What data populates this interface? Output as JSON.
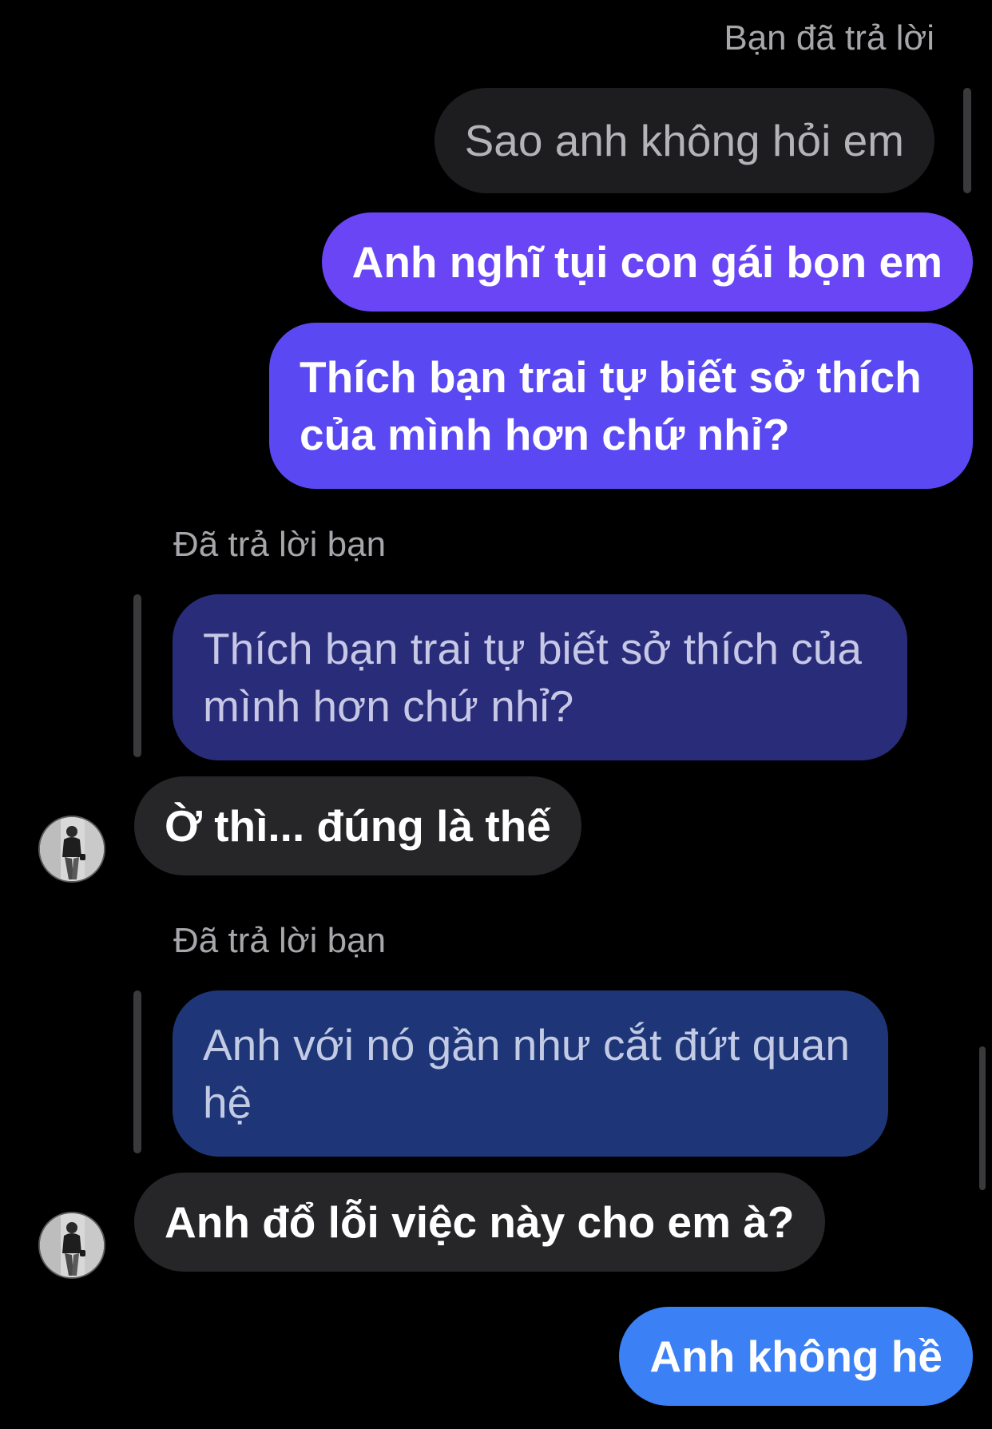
{
  "messages": [
    {
      "reply_label": "Bạn đã trả lời",
      "text": "Sao anh không hỏi em"
    },
    {
      "text": "Anh nghĩ tụi con gái bọn em"
    },
    {
      "text": "Thích bạn trai tự biết sở thích của mình hơn chứ nhỉ?"
    },
    {
      "reply_label": "Đã trả lời bạn",
      "quoted": "Thích bạn trai tự biết sở thích của mình hơn chứ nhỉ?",
      "text": "Ờ thì... đúng là thế"
    },
    {
      "reply_label": "Đã trả lời bạn",
      "quoted": "Anh với nó gần như cắt đứt quan hệ",
      "text": "Anh đổ lỗi việc này cho em à?"
    },
    {
      "text": "Anh không hề"
    }
  ],
  "colors": {
    "background": "#000000",
    "sent_purple": "#6a45f6",
    "sent_violet": "#5a49f2",
    "sent_blue": "#3c80f6",
    "received": "#262628",
    "quoted_navy": "#292c79",
    "quoted_blue": "#1e3677"
  }
}
